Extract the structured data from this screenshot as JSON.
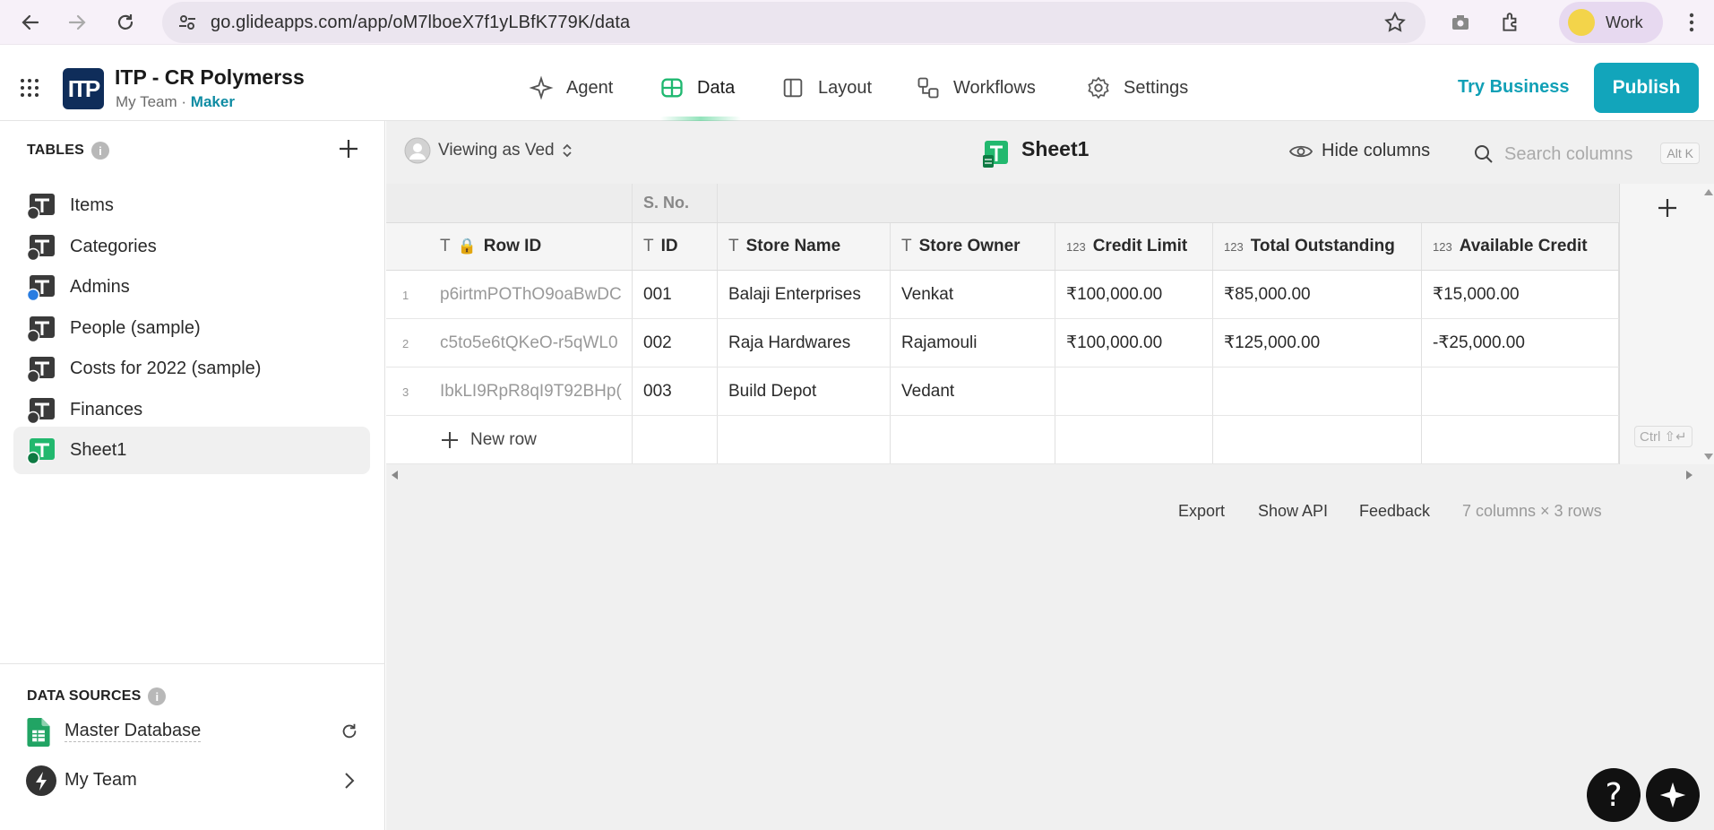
{
  "browser": {
    "url": "go.glideapps.com/app/oM7lboeX7f1yLBfK779K/data",
    "profile_label": "Work",
    "icons": [
      "back-icon",
      "forward-icon",
      "reload-icon",
      "site-settings-icon",
      "star-icon",
      "camera-icon",
      "extensions-icon",
      "kebab-menu-icon"
    ]
  },
  "header": {
    "logo_text": "ITP",
    "app_title": "ITP - CR Polymerss",
    "team": "My Team",
    "separator": "·",
    "role": "Maker",
    "tabs": [
      {
        "label": "Agent",
        "icon": "sparkle-icon"
      },
      {
        "label": "Data",
        "icon": "table-icon",
        "active": true
      },
      {
        "label": "Layout",
        "icon": "layout-icon"
      },
      {
        "label": "Workflows",
        "icon": "workflow-icon"
      },
      {
        "label": "Settings",
        "icon": "gear-icon"
      }
    ],
    "try_business": "Try Business",
    "publish": "Publish"
  },
  "sidebar": {
    "tables_title": "TABLES",
    "info_glyph": "i",
    "tables": [
      {
        "label": "Items"
      },
      {
        "label": "Categories"
      },
      {
        "label": "Admins"
      },
      {
        "label": "People (sample)"
      },
      {
        "label": "Costs for 2022 (sample)"
      },
      {
        "label": "Finances"
      },
      {
        "label": "Sheet1",
        "active": true
      }
    ],
    "data_sources_title": "DATA SOURCES",
    "sources": [
      {
        "label": "Master Database",
        "action_icon": "refresh-icon"
      },
      {
        "label": "My Team",
        "action_icon": "chevron-right-icon"
      }
    ]
  },
  "toolbar": {
    "viewing_as": "Viewing as Ved",
    "sheet_title": "Sheet1",
    "hide_columns": "Hide columns",
    "search_placeholder": "Search columns",
    "search_shortcut": "Alt K"
  },
  "grid": {
    "group_header": "S. No.",
    "columns": [
      {
        "label": "Row ID",
        "type": "T",
        "locked": true
      },
      {
        "label": "ID",
        "type": "T"
      },
      {
        "label": "Store Name",
        "type": "T"
      },
      {
        "label": "Store Owner",
        "type": "T"
      },
      {
        "label": "Credit Limit",
        "type": "123"
      },
      {
        "label": "Total Outstanding",
        "type": "123"
      },
      {
        "label": "Available Credit",
        "type": "123"
      }
    ],
    "rows": [
      {
        "num": "1",
        "cells": [
          "p6irtmPOThO9oaBwDC",
          "001",
          "Balaji Enterprises",
          "Venkat",
          "₹100,000.00",
          "₹85,000.00",
          "₹15,000.00"
        ]
      },
      {
        "num": "2",
        "cells": [
          "c5to5e6tQKeO-r5qWL0",
          "002",
          "Raja Hardwares",
          "Rajamouli",
          "₹100,000.00",
          "₹125,000.00",
          "-₹25,000.00"
        ]
      },
      {
        "num": "3",
        "cells": [
          "IbkLI9RpR8qI9T92BHp(",
          "003",
          "Build Depot",
          "Vedant",
          "",
          "",
          ""
        ]
      }
    ],
    "new_row": "New row",
    "new_row_shortcut": "Ctrl ⇧↵"
  },
  "footer": {
    "export": "Export",
    "show_api": "Show API",
    "feedback": "Feedback",
    "summary": "7 columns × 3 rows"
  },
  "fab": {
    "help": "?"
  }
}
